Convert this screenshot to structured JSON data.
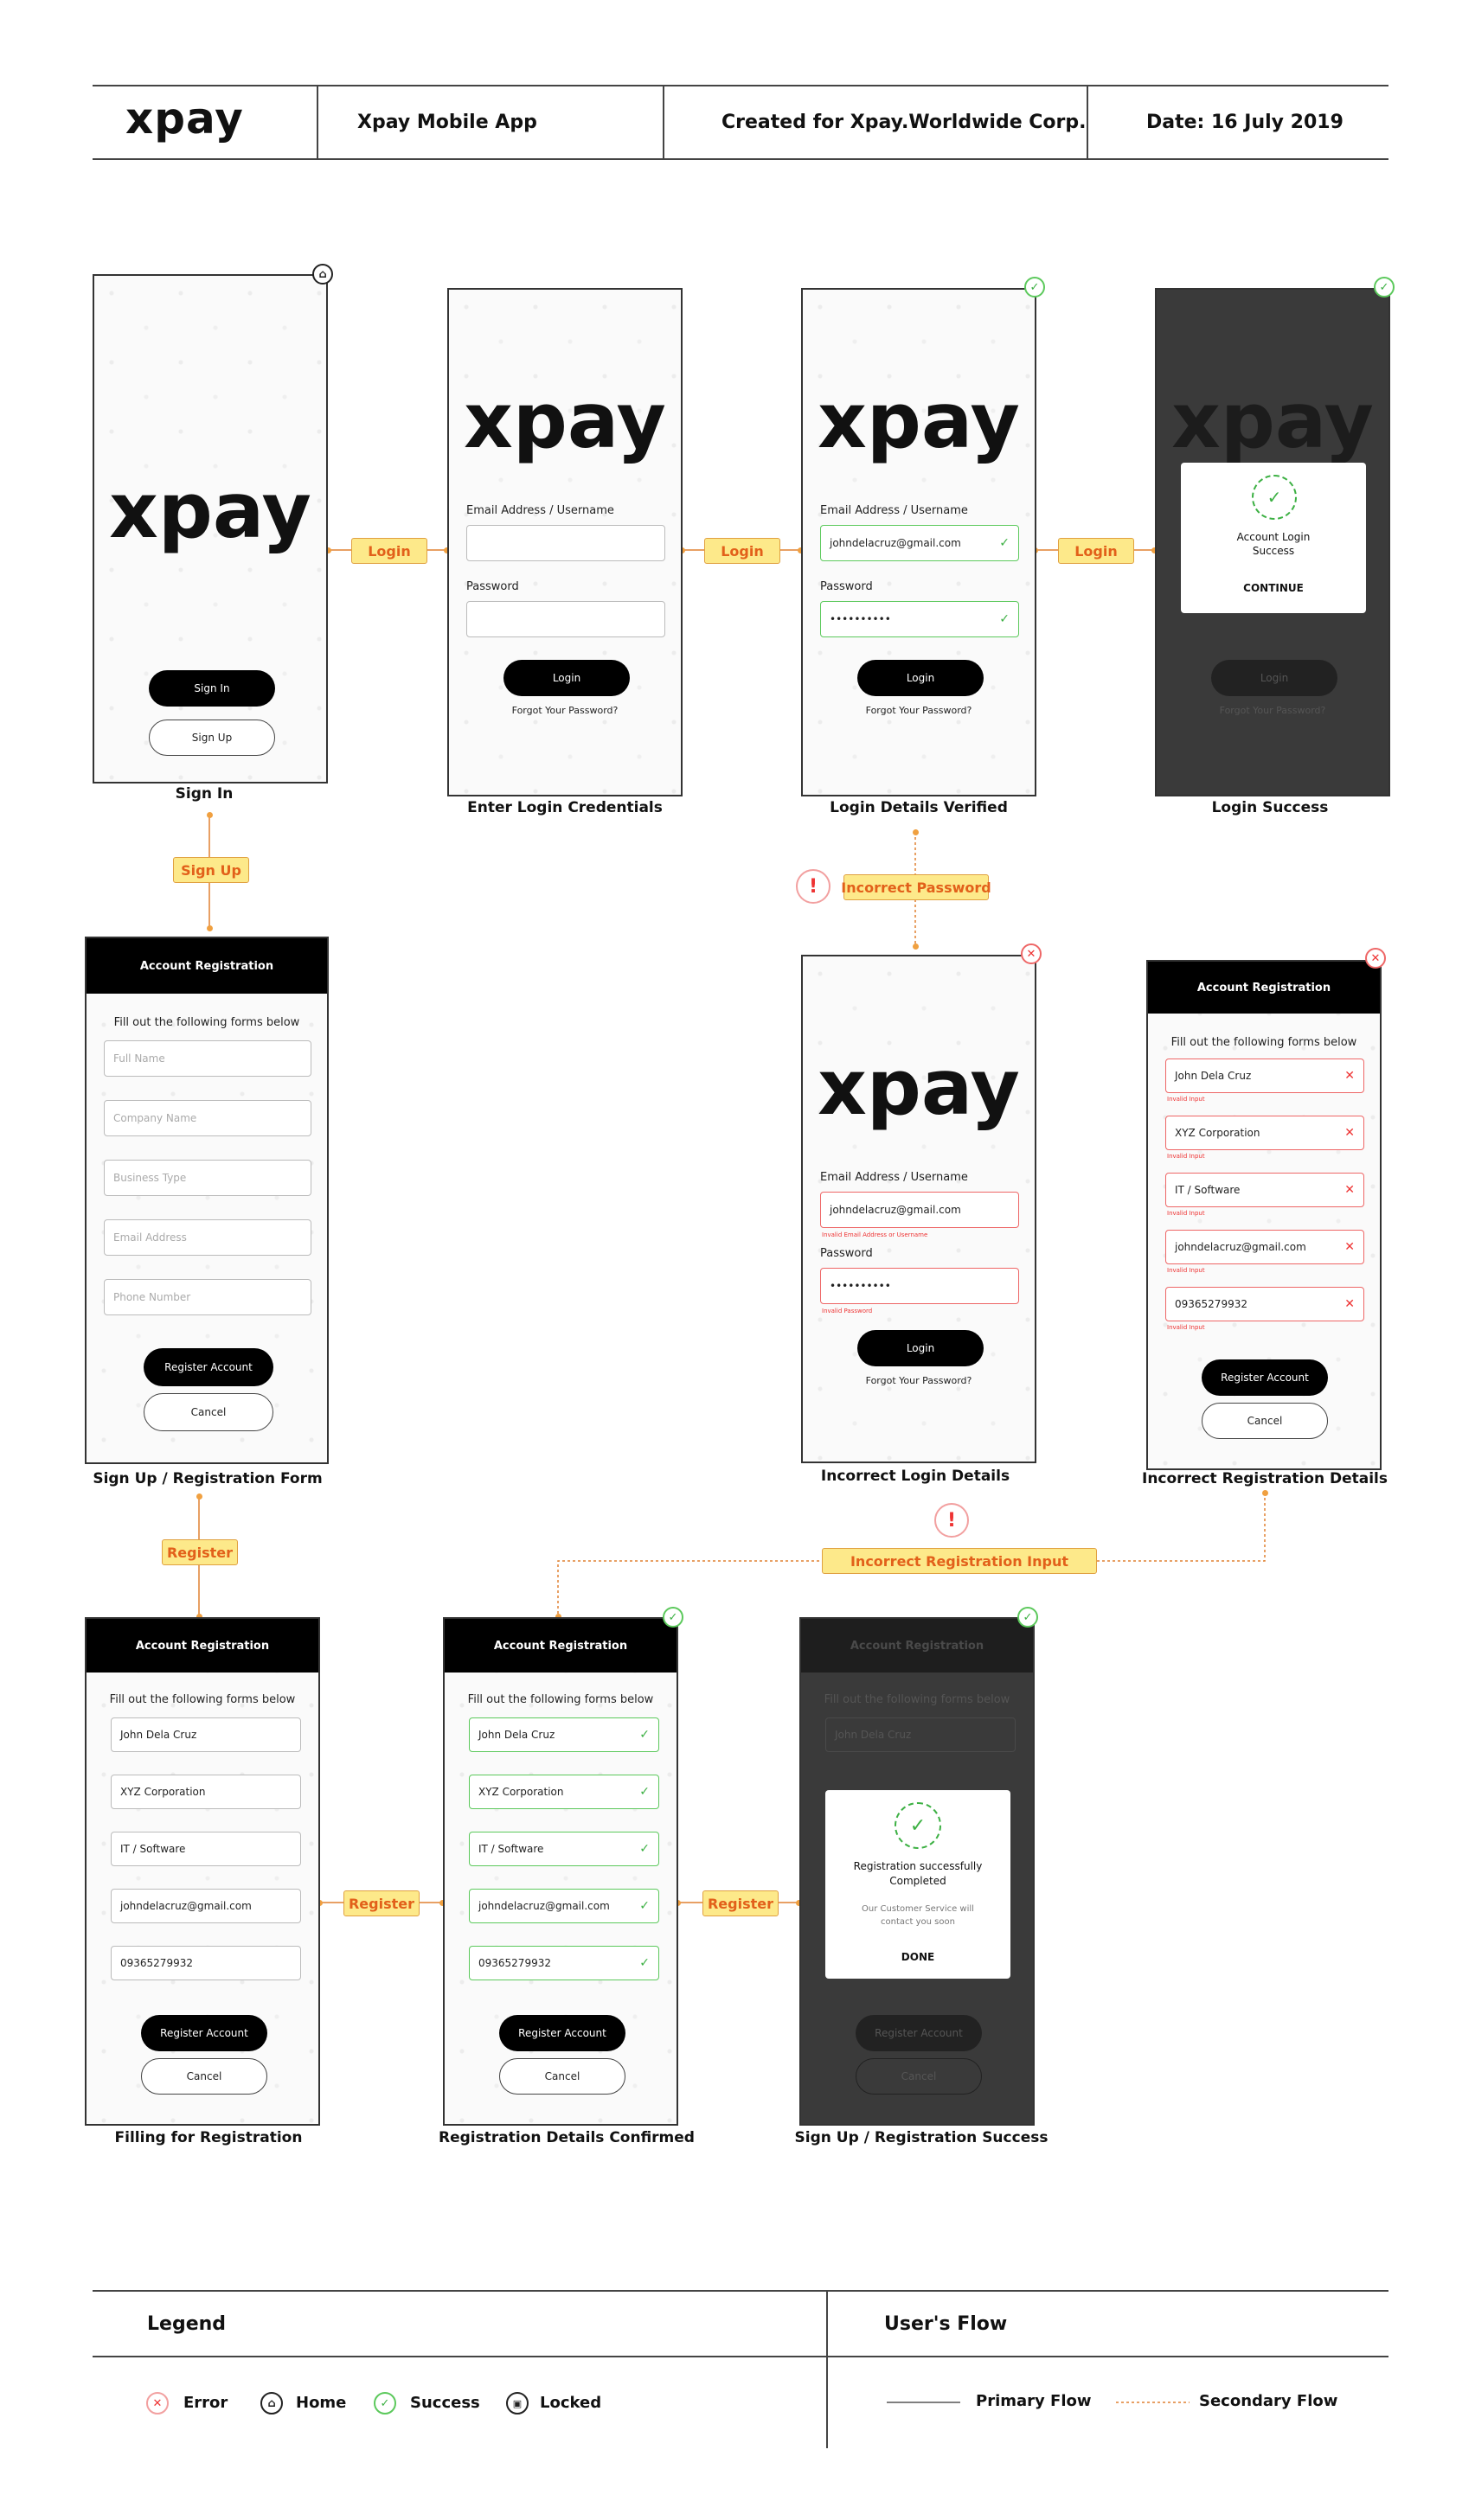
{
  "header": {
    "logo": "xpay",
    "project": "Xpay Mobile App",
    "client": "Created for Xpay.Worldwide Corp.",
    "date": "Date: 16 July 2019"
  },
  "common": {
    "logo": "xpay",
    "sign_in": "Sign In",
    "sign_up": "Sign Up",
    "email_label": "Email Address / Username",
    "password_label": "Password",
    "login_btn": "Login",
    "forgot": "Forgot Your Password?",
    "email_value": "johndelacruz@gmail.com",
    "password_mask": "••••••••••",
    "reg_title": "Account Registration",
    "reg_sub": "Fill out the following forms below",
    "register_btn": "Register Account",
    "cancel_btn": "Cancel",
    "invalid_input": "Invalid Input",
    "invalid_email": "Invalid Email Address or Username",
    "invalid_password": "Invalid Password"
  },
  "placeholders": [
    "Full Name",
    "Company Name",
    "Business Type",
    "Email Address",
    "Phone Number"
  ],
  "reg_values": [
    "John Dela Cruz",
    "XYZ Corporation",
    "IT / Software",
    "johndelacruz@gmail.com",
    "09365279932"
  ],
  "dialogs": {
    "login_success": "Account Login Success",
    "continue": "CONTINUE",
    "reg_success": "Registration successfully Completed",
    "reg_contact": "Our Customer Service will contact you soon",
    "done": "DONE"
  },
  "captions": {
    "sign_in": "Sign In",
    "enter_login": "Enter Login Credentials",
    "verified": "Login Details Verified",
    "login_success": "Login Success",
    "reg_form": "Sign Up / Registration Form",
    "incorrect_login": "Incorrect Login Details",
    "incorrect_reg": "Incorrect Registration Details",
    "filling": "Filling for Registration",
    "confirmed": "Registration Details Confirmed",
    "reg_success": "Sign Up / Registration Success"
  },
  "flow_labels": {
    "login": "Login",
    "sign_up": "Sign Up",
    "incorrect_password": "Incorrect Password",
    "register": "Register",
    "incorrect_reg_input": "Incorrect Registration Input"
  },
  "legend": {
    "title": "Legend",
    "error": "Error",
    "home": "Home",
    "success": "Success",
    "locked": "Locked",
    "flow_title": "User's Flow",
    "primary": "Primary Flow",
    "secondary": "Secondary Flow"
  },
  "colors": {
    "accent_tag": "#fde98a",
    "tag_text": "#e2601a",
    "success": "#3cb043",
    "error": "#e33333"
  }
}
